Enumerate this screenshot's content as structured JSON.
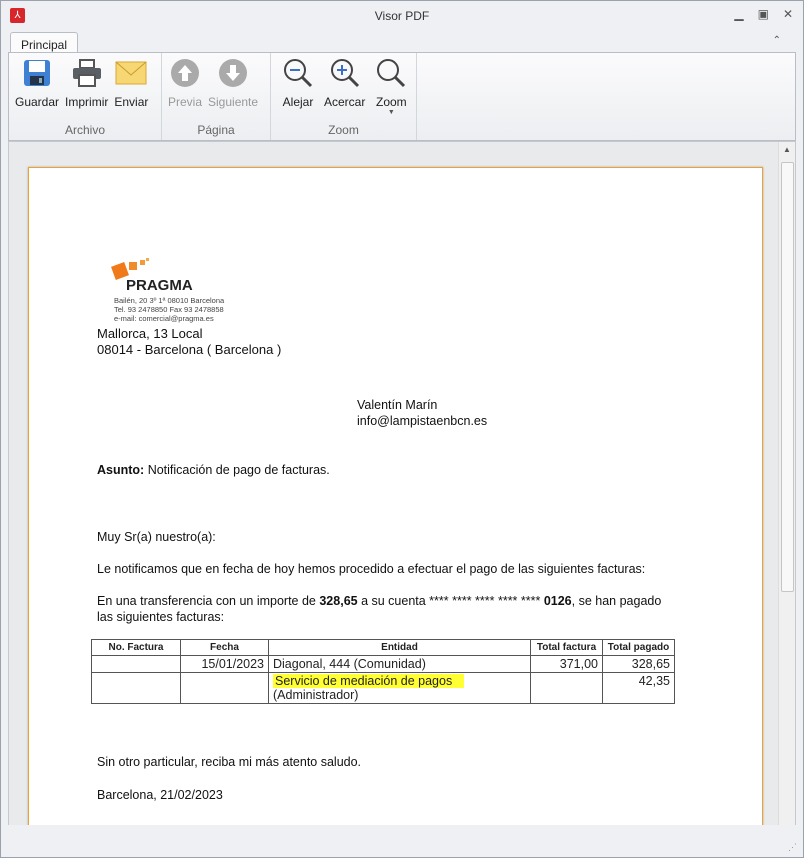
{
  "window": {
    "title": "Visor PDF"
  },
  "tabs": [
    {
      "label": "Principal"
    }
  ],
  "ribbon": {
    "groups": [
      {
        "label": "Archivo",
        "buttons": [
          "Guardar",
          "Imprimir",
          "Enviar"
        ]
      },
      {
        "label": "Página",
        "buttons": [
          "Previa",
          "Siguiente"
        ]
      },
      {
        "label": "Zoom",
        "buttons": [
          "Alejar",
          "Acercar",
          "Zoom"
        ]
      }
    ]
  },
  "document": {
    "logo_text": "PRAGMA",
    "logo_lines": [
      "Bailén, 20 3º 1ª 08010 Barcelona",
      "Tel. 93 2478850 Fax 93 2478858",
      "e-mail: comercial@pragma.es"
    ],
    "sender_address": [
      "Mallorca, 13 Local",
      "08014 - Barcelona ( Barcelona )"
    ],
    "recipient": [
      "Valentín Marín",
      "info@lampistaenbcn.es"
    ],
    "subject_label": "Asunto:",
    "subject": " Notificación de pago de facturas.",
    "greeting": "Muy Sr(a) nuestro(a):",
    "para1": "Le notificamos que en fecha de hoy hemos procedido a efectuar el pago de las siguientes facturas:",
    "para2_a": "En una transferencia con un importe de ",
    "para2_amount": "328,65",
    "para2_b": " a su cuenta **** **** **** **** **** ",
    "para2_account": "0126",
    "para2_c": ", se han pagado",
    "para2_line2": "las siguientes facturas:",
    "table": {
      "headers": [
        "No. Factura",
        "Fecha",
        "Entidad",
        "Total factura",
        "Total pagado"
      ],
      "rows": [
        {
          "no": "",
          "fecha": "15/01/2023",
          "entidad": "Diagonal, 444 (Comunidad)",
          "entidad2": "",
          "total": "371,00",
          "pagado": "328,65"
        },
        {
          "no": "",
          "fecha": "",
          "entidad": "Servicio de mediación de pagos",
          "entidad2": "(Administrador)",
          "total": "",
          "pagado": "42,35"
        }
      ]
    },
    "closing": "Sin otro particular, reciba mi más atento saludo.",
    "place_date": "Barcelona, 21/02/2023"
  }
}
